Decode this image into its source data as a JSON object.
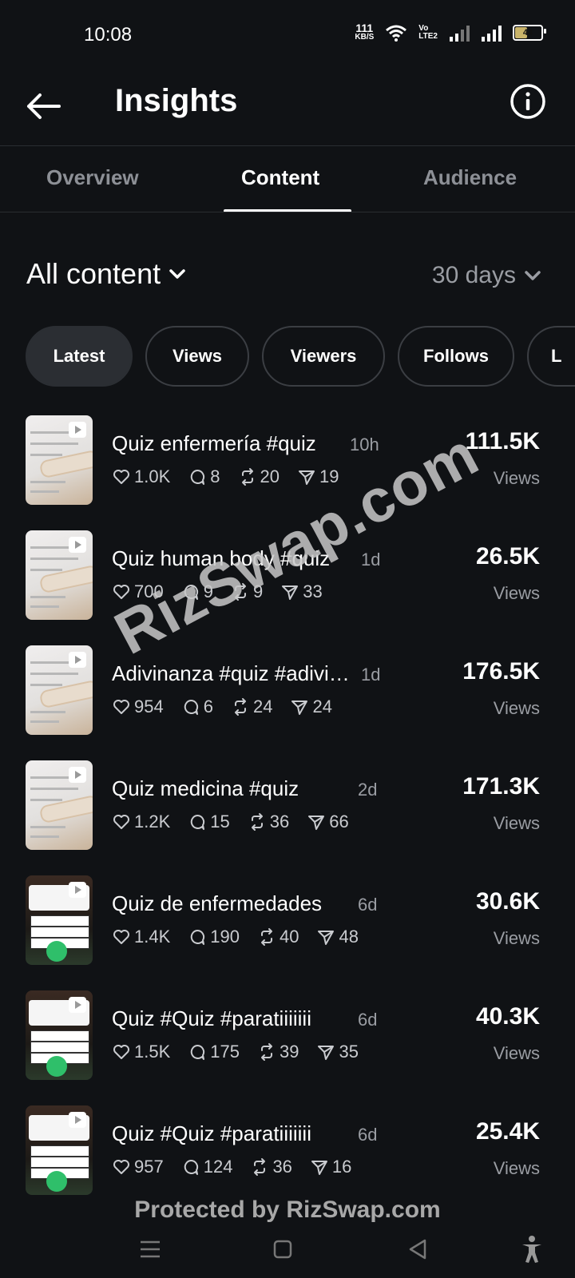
{
  "status_bar": {
    "time": "10:08",
    "net_speed_value": "111",
    "net_speed_unit": "KB/S",
    "volte_top": "Vo",
    "volte_bottom": "LTE2",
    "battery": "44"
  },
  "header": {
    "title": "Insights"
  },
  "tabs": [
    {
      "label": "Overview",
      "active": false
    },
    {
      "label": "Content",
      "active": true
    },
    {
      "label": "Audience",
      "active": false
    }
  ],
  "filters": {
    "content_filter": "All content",
    "period": "30 days"
  },
  "chips": [
    {
      "label": "Latest",
      "active": true
    },
    {
      "label": "Views",
      "active": false
    },
    {
      "label": "Viewers",
      "active": false
    },
    {
      "label": "Follows",
      "active": false
    },
    {
      "label": "L",
      "active": false
    }
  ],
  "posts": [
    {
      "caption": "Quiz enfermería #quiz",
      "age": "10h",
      "likes": "1.0K",
      "comments": "8",
      "reposts": "20",
      "shares": "19",
      "views": "111.5K",
      "views_label": "Views",
      "thumb": "light"
    },
    {
      "caption": "Quiz human body #quiz",
      "age": "1d",
      "likes": "700",
      "comments": "9",
      "reposts": "9",
      "shares": "33",
      "views": "26.5K",
      "views_label": "Views",
      "thumb": "light"
    },
    {
      "caption": "Adivinanza #quiz #adivinanza",
      "age": "1d",
      "likes": "954",
      "comments": "6",
      "reposts": "24",
      "shares": "24",
      "views": "176.5K",
      "views_label": "Views",
      "thumb": "light"
    },
    {
      "caption": "Quiz medicina #quiz",
      "age": "2d",
      "likes": "1.2K",
      "comments": "15",
      "reposts": "36",
      "shares": "66",
      "views": "171.3K",
      "views_label": "Views",
      "thumb": "light"
    },
    {
      "caption": "Quiz de enfermedades",
      "age": "6d",
      "likes": "1.4K",
      "comments": "190",
      "reposts": "40",
      "shares": "48",
      "views": "30.6K",
      "views_label": "Views",
      "thumb": "dark"
    },
    {
      "caption": "Quiz #Quiz #paratiiiiiii",
      "age": "6d",
      "likes": "1.5K",
      "comments": "175",
      "reposts": "39",
      "shares": "35",
      "views": "40.3K",
      "views_label": "Views",
      "thumb": "dark"
    },
    {
      "caption": "Quiz #Quiz #paratiiiiiii",
      "age": "6d",
      "likes": "957",
      "comments": "124",
      "reposts": "36",
      "shares": "16",
      "views": "25.4K",
      "views_label": "Views",
      "thumb": "dark"
    }
  ],
  "watermark": "RizSwap.com",
  "footer_watermark": "Protected by RizSwap.com",
  "colors": {
    "background": "#101215",
    "text_secondary": "#9a9da3",
    "chip_active": "#2b2e33"
  },
  "icons": [
    "back-arrow-icon",
    "info-icon",
    "chevron-down-icon",
    "heart-icon",
    "comment-icon",
    "repost-icon",
    "share-icon",
    "menu-icon",
    "home-square-icon",
    "back-triangle-icon",
    "accessibility-icon"
  ]
}
